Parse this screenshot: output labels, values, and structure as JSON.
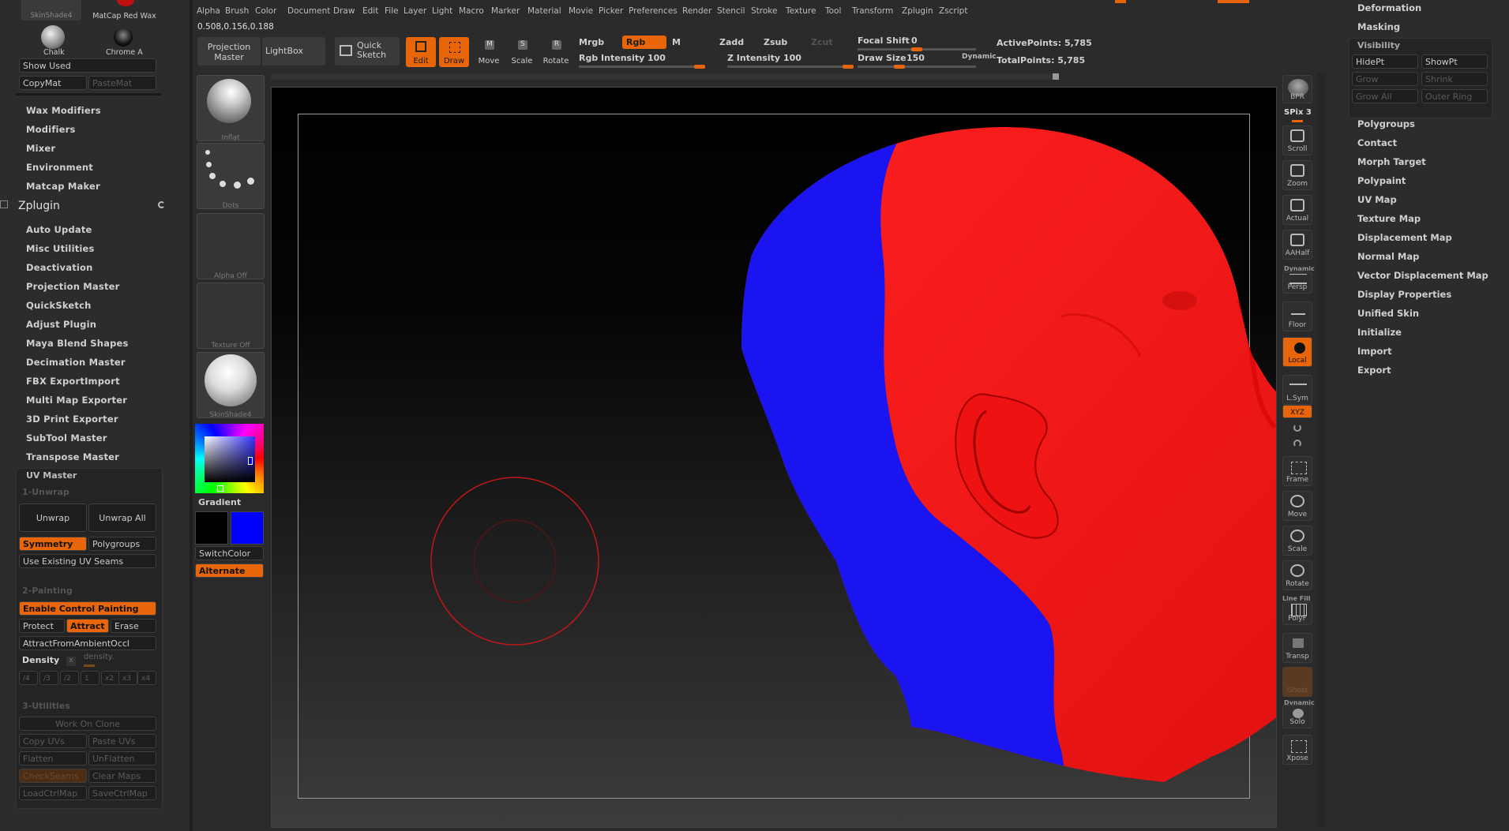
{
  "left_panel": {
    "materials": {
      "top_labels": [
        "SkinShade4",
        "MatCap Red Wax"
      ],
      "chalk": "Chalk",
      "chrome": "Chrome A"
    },
    "show_used": "Show Used",
    "copymat": "CopyMat",
    "pastemat": "PasteMat",
    "menu_items_top": [
      "Wax Modifiers",
      "Modifiers",
      "Mixer",
      "Environment",
      "Matcap Maker"
    ],
    "zplugin_title": "Zplugin",
    "zplugin_items": [
      "Auto Update",
      "Misc Utilities",
      "Deactivation",
      "Projection Master",
      "QuickSketch",
      "Adjust Plugin",
      "Maya Blend Shapes",
      "Decimation Master",
      "FBX ExportImport",
      "Multi Map Exporter",
      "3D Print Exporter",
      "SubTool Master",
      "Transpose Master"
    ],
    "uv_master": {
      "title": "UV Master",
      "section1": "1-Unwrap",
      "unwrap": "Unwrap",
      "unwrap_all": "Unwrap All",
      "symmetry": "Symmetry",
      "polygroups": "Polygroups",
      "use_existing": "Use Existing UV Seams",
      "section2": "2-Painting",
      "enable_control": "Enable Control Painting",
      "protect": "Protect",
      "attract": "Attract",
      "erase": "Erase",
      "attract_ambient": "AttractFromAmbientOccl",
      "density": "Density",
      "density_slider": "density.",
      "density_x": "x",
      "density_values": [
        "/4",
        "/3",
        "/2",
        "1",
        "x2",
        "x3",
        "x4"
      ],
      "section3": "3-Utilities",
      "work_on_clone": "Work On Clone",
      "copy_uvs": "Copy UVs",
      "paste_uvs": "Paste UVs",
      "flatten": "Flatten",
      "unflatten": "UnFlatten",
      "checkseams": "CheckSeams",
      "clear_maps": "Clear Maps",
      "load_ctrl": "LoadCtrlMap",
      "save_ctrl": "SaveCtrlMap"
    }
  },
  "menubar": [
    "Alpha",
    "Brush",
    "Color",
    "Document",
    "Draw",
    "Edit",
    "File",
    "Layer",
    "Light",
    "Macro",
    "Marker",
    "Material",
    "Movie",
    "Picker",
    "Preferences",
    "Render",
    "Stencil",
    "Stroke",
    "Texture",
    "Tool",
    "Transform",
    "Zplugin",
    "Zscript"
  ],
  "color_readout": "0.508,0.156,0.188",
  "toolbar": {
    "projection_master": "Projection Master",
    "lightbox": "LightBox",
    "quick_sketch": "Quick Sketch",
    "edit": "Edit",
    "draw": "Draw",
    "move": "Move",
    "scale": "Scale",
    "rotate": "Rotate",
    "mrgb": "Mrgb",
    "rgb": "Rgb",
    "m": "M",
    "zadd": "Zadd",
    "zsub": "Zsub",
    "zcut": "Zcut",
    "rgb_intensity_label": "Rgb Intensity",
    "rgb_intensity": "100",
    "z_intensity_label": "Z Intensity",
    "z_intensity": "100",
    "focal_shift_label": "Focal Shift",
    "focal_shift": "0",
    "draw_size_label": "Draw Size",
    "draw_size": "150",
    "dynamic": "Dynamic",
    "active_points": "ActivePoints: 5,785",
    "total_points": "TotalPoints: 5,785"
  },
  "tool_column": {
    "brush": "Inflat",
    "stroke": "Dots",
    "alpha": "Alpha Off",
    "texture": "Texture Off",
    "material": "SkinShade4",
    "gradient": "Gradient",
    "switch_color": "SwitchColor",
    "alternate": "Alternate",
    "colors": {
      "main": "#000000",
      "secondary": "#0000ff"
    }
  },
  "right_shelf": {
    "bpr": "BPR",
    "spix": "SPix 3",
    "scroll": "Scroll",
    "zoom": "Zoom",
    "actual": "Actual",
    "aahalf": "AAHalf",
    "dynamic": "Dynamic",
    "persp": "Persp",
    "floor": "Floor",
    "local": "Local",
    "lsym": "L.Sym",
    "xyz": "XYZ",
    "frame": "Frame",
    "move": "Move",
    "scale": "Scale",
    "rotate": "Rotate",
    "line_fill": "Line Fill",
    "polyf": "PolyF",
    "transp": "Transp",
    "ghost": "Ghost",
    "dynamic2": "Dynamic",
    "solo": "Solo",
    "xpose": "Xpose"
  },
  "right_panel": {
    "deformation": "Deformation",
    "masking": "Masking",
    "visibility": "Visibility",
    "hidept": "HidePt",
    "showpt": "ShowPt",
    "grow": "Grow",
    "shrink": "Shrink",
    "grow_all": "Grow All",
    "outer_ring": "Outer Ring",
    "items": [
      "Polygroups",
      "Contact",
      "Morph Target",
      "Polypaint",
      "UV Map",
      "Texture Map",
      "Displacement Map",
      "Normal Map",
      "Vector Displacement Map",
      "Display Properties",
      "Unified Skin",
      "Initialize",
      "Import",
      "Export"
    ]
  }
}
